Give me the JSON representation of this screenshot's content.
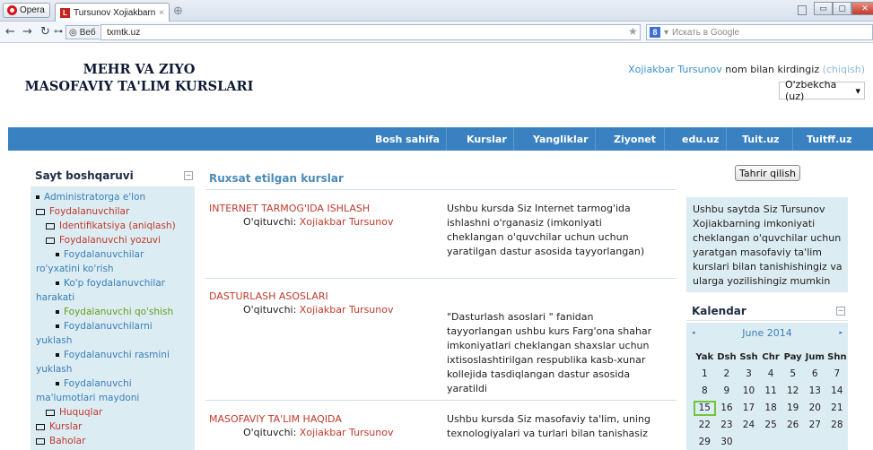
{
  "browser": {
    "menu_button": "Opera",
    "tab_title": "Tursunov Xojiakbarnin...",
    "tab_close": "×",
    "new_tab": "⊕",
    "web_badge": "Веб",
    "url": "txmtk.uz",
    "search_placeholder": "Искать в Google",
    "window_buttons": [
      "▭",
      "▢",
      "✕"
    ]
  },
  "site": {
    "title_line1": "MEHR VA ZIYO",
    "title_line2": "MASOFAVIY TA'LIM KURSLARI"
  },
  "login": {
    "user": "Xojiakbar Tursunov",
    "text": " nom bilan kirdingiz ",
    "logout": "(chiqish)"
  },
  "language": {
    "selected": "O'zbekcha (uz)"
  },
  "menu": [
    "Bosh sahifa",
    "Kurslar",
    "Yangliklar",
    "Ziyonet",
    "edu.uz",
    "Tuit.uz",
    "Tuitff.uz"
  ],
  "admin_block": {
    "title": "Sayt boshqaruvi",
    "hide": "−",
    "items": [
      {
        "icon": "bullet",
        "indent": 0,
        "text": "Administratorga e'lon",
        "style": "blue"
      },
      {
        "icon": "folder-open",
        "indent": 0,
        "text": "Foydalanuvchilar",
        "style": "red"
      },
      {
        "icon": "folder",
        "indent": 1,
        "text": "Identifikatsiya (aniqlash)",
        "style": "red"
      },
      {
        "icon": "folder-open",
        "indent": 1,
        "text": "Foydalanuvchi yozuvi",
        "style": "red"
      },
      {
        "icon": "bullet",
        "indent": 2,
        "text": "Foydalanuvchilar",
        "style": "blue"
      },
      {
        "icon": "",
        "indent": 0,
        "text": "ro'yxatini ko'rish",
        "style": "blue"
      },
      {
        "icon": "bullet",
        "indent": 2,
        "text": "Ko'p foydalanuvchilar",
        "style": "blue"
      },
      {
        "icon": "",
        "indent": 0,
        "text": "harakati",
        "style": "blue"
      },
      {
        "icon": "bullet",
        "indent": 2,
        "text": "Foydalanuvchi qo'shish",
        "style": "green"
      },
      {
        "icon": "bullet",
        "indent": 2,
        "text": "Foydalanuvchilarni",
        "style": "blue"
      },
      {
        "icon": "",
        "indent": 0,
        "text": "yuklash",
        "style": "blue"
      },
      {
        "icon": "bullet",
        "indent": 2,
        "text": "Foydalanuvchi rasmini",
        "style": "blue"
      },
      {
        "icon": "",
        "indent": 0,
        "text": "yuklash",
        "style": "blue"
      },
      {
        "icon": "bullet",
        "indent": 2,
        "text": "Foydalanuvchi",
        "style": "blue"
      },
      {
        "icon": "",
        "indent": 0,
        "text": "ma'lumotlari maydoni",
        "style": "blue"
      },
      {
        "icon": "folder",
        "indent": 1,
        "text": "Huquqlar",
        "style": "red"
      },
      {
        "icon": "folder",
        "indent": 0,
        "text": "Kurslar",
        "style": "red"
      },
      {
        "icon": "folder",
        "indent": 0,
        "text": "Baholar",
        "style": "red"
      }
    ]
  },
  "main": {
    "heading": "Ruxsat etilgan kurslar",
    "teacher_label": "O'qituvchi: ",
    "courses": [
      {
        "name": "INTERNET TARMOG'IDA ISHLASH",
        "teacher": "Xojiakbar Tursunov",
        "summary": "Ushbu kursda Siz Internet tarmog'ida ishlashni o'rganasiz (imkoniyati cheklangan o'quvchilar uchun uchun yaratilgan dastur asosida tayyorlangan)"
      },
      {
        "name": "DASTURLASH ASOSLARI",
        "teacher": "Xojiakbar Tursunov",
        "summary": "\"Dasturlash asoslari \" fanidan tayyorlangan ushbu kurs Farg'ona shahar imkoniyatlari cheklangan shaxslar uchun ixtisoslashtirilgan respublika kasb-xunar kollejida tasdiqlangan dastur asosida yaratildi"
      },
      {
        "name": "MASOFAVIY TA'LIM HAQIDA",
        "teacher": "Xojiakbar Tursunov",
        "summary": "Ushbu kursda Siz masofaviy ta'lim, uning texnologiyalari va turlari bilan tanishasiz"
      }
    ]
  },
  "right": {
    "edit_button": "Tahrir qilish",
    "info": "Ushbu saytda Siz Tursunov Xojiakbarning imkoniyati cheklangan o'quvchilar uchun yaratgan masofaviy ta'lim kurslari bilan tanishishingiz va ularga yozilishingiz mumkin",
    "calendar": {
      "title": "Kalendar",
      "hide": "−",
      "month": "June 2014",
      "prev": "◂",
      "next": "▸",
      "weekdays": [
        "Yak",
        "Dsh",
        "Ssh",
        "Chr",
        "Pay",
        "Jum",
        "Shn"
      ],
      "days": [
        "1",
        "2",
        "3",
        "4",
        "5",
        "6",
        "7",
        "8",
        "9",
        "10",
        "11",
        "12",
        "13",
        "14",
        "15",
        "16",
        "17",
        "18",
        "19",
        "20",
        "21",
        "22",
        "23",
        "24",
        "25",
        "26",
        "27",
        "28",
        "29",
        "30"
      ],
      "today": "15"
    }
  }
}
